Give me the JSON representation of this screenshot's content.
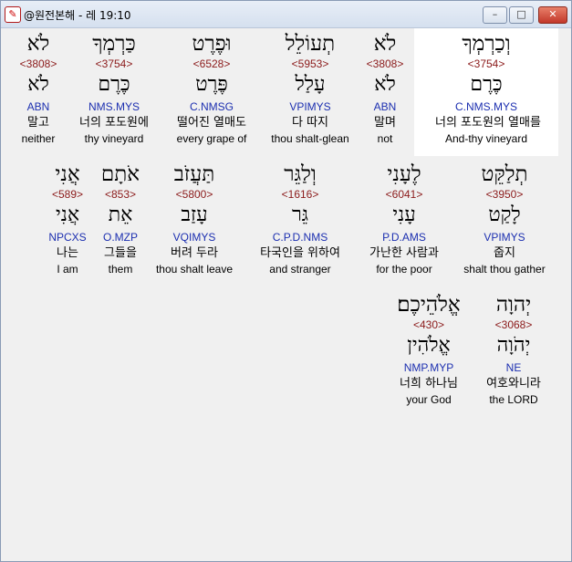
{
  "window": {
    "title": "@원전본해 - 레 19:10",
    "buttons": {
      "minimize": "–",
      "maximize": "□",
      "close": "✕"
    }
  },
  "rows": [
    [
      {
        "heb": "וְכַרְמְךָ",
        "strong": "<3754>",
        "lemma": "כֶּרֶם",
        "morph": "C.NMS.MYS",
        "kor": "너의 포도원의 열매를",
        "eng": "And-thy vineyard"
      },
      {
        "heb": "לֹא",
        "strong": "<3808>",
        "lemma": "לֹא",
        "morph": "ABN",
        "kor": "말며",
        "eng": "not"
      },
      {
        "heb": "תְעוֹלֵל",
        "strong": "<5953>",
        "lemma": "עָלַל",
        "morph": "VPIMYS",
        "kor": "다 따지",
        "eng": "thou shalt-glean"
      },
      {
        "heb": "וּפֶרֶט",
        "strong": "<6528>",
        "lemma": "פֶּרֶט",
        "morph": "C.NMSG",
        "kor": "떨어진 열매도",
        "eng": "every grape of"
      },
      {
        "heb": "כַּרְמְךָ",
        "strong": "<3754>",
        "lemma": "כֶּרֶם",
        "morph": "NMS.MYS",
        "kor": "너의 포도원에",
        "eng": "thy vineyard"
      },
      {
        "heb": "לֹא",
        "strong": "<3808>",
        "lemma": "לֹא",
        "morph": "ABN",
        "kor": "말고",
        "eng": "neither"
      }
    ],
    [
      {
        "heb": "תְלַקֵּט",
        "strong": "<3950>",
        "lemma": "לָקַט",
        "morph": "VPIMYS",
        "kor": "줍지",
        "eng": "shalt thou gather"
      },
      {
        "heb": "לֶעָנִי",
        "strong": "<6041>",
        "lemma": "עָנִי",
        "morph": "P.D.AMS",
        "kor": "가난한 사람과",
        "eng": "for the poor"
      },
      {
        "heb": "וְלַגֵּר",
        "strong": "<1616>",
        "lemma": "גֵּר",
        "morph": "C.P.D.NMS",
        "kor": "타국인을 위하여",
        "eng": "and stranger"
      },
      {
        "heb": "תַּעֲזֹב",
        "strong": "<5800>",
        "lemma": "עָזַב",
        "morph": "VQIMYS",
        "kor": "버려 두라",
        "eng": "thou shalt leave"
      },
      {
        "heb": "אֹתָם",
        "strong": "<853>",
        "lemma": "אֵת",
        "morph": "O.MZP",
        "kor": "그들을",
        "eng": "them"
      },
      {
        "heb": "אֲנִי",
        "strong": "<589>",
        "lemma": "אֲנִי",
        "morph": "NPCXS",
        "kor": "나는",
        "eng": "I am"
      }
    ],
    [
      {
        "heb": "יְהוָה",
        "strong": "<3068>",
        "lemma": "יְהֹוָה",
        "morph": "NE",
        "kor": "여호와니라",
        "eng": "the LORD"
      },
      {
        "heb": "אֱלֹהֵיכֶם׃",
        "strong": "<430>",
        "lemma": "אֱלֹהִין",
        "morph": "NMP.MYP",
        "kor": "너희 하나님",
        "eng": "your God"
      }
    ]
  ]
}
